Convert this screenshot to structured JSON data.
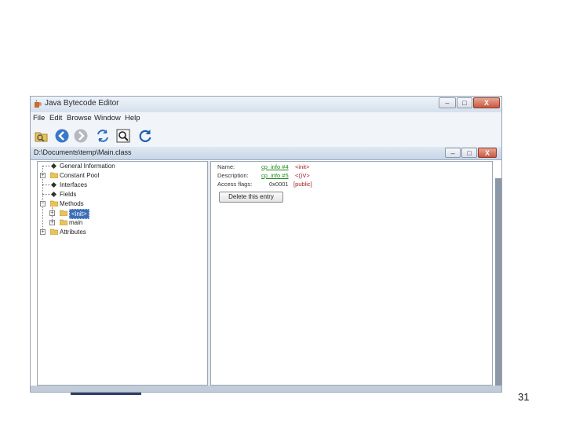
{
  "app": {
    "title": "Java Bytecode Editor",
    "menu": [
      "File",
      "Edit",
      "Browse",
      "Window",
      "Help"
    ],
    "window_buttons": {
      "minimize": "–",
      "maximize": "□",
      "close": "X"
    }
  },
  "toolbar": {
    "icons": [
      "open-file-icon",
      "back-arrow-icon",
      "forward-arrow-icon",
      "refresh-icon",
      "inspect-icon",
      "reload-icon"
    ]
  },
  "document": {
    "title": "D:\\Documents\\temp\\Main.class",
    "tree": {
      "general_information": "General Information",
      "constant_pool": "Constant Pool",
      "interfaces": "Interfaces",
      "fields": "Fields",
      "methods": "Methods",
      "init": "<init>",
      "main": "main",
      "attributes": "Attributes"
    },
    "details": {
      "name_label": "Name:",
      "name_link": "cp_info #4",
      "name_value": "<init>",
      "description_label": "Description:",
      "description_link": "cp_info #5",
      "description_value": "<()V>",
      "access_label": "Access flags:",
      "access_value": "0x0001",
      "access_flag": "[public]",
      "delete_button": "Delete this entry"
    }
  },
  "slide": {
    "number": "31"
  },
  "colors": {
    "accent": "#3d6fb8",
    "link": "#1c8a1c",
    "value": "#9b1c1c"
  }
}
